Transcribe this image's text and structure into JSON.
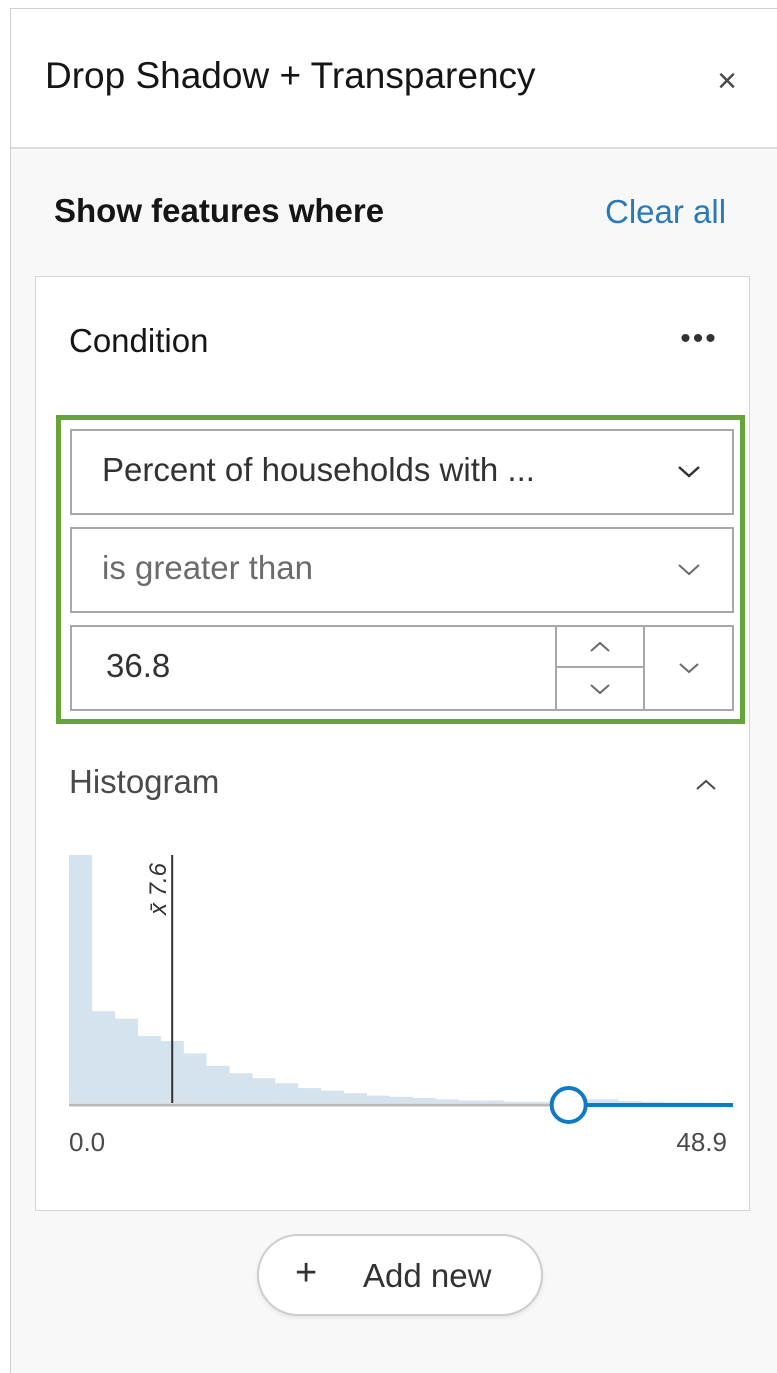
{
  "header": {
    "title": "Drop Shadow + Transparency",
    "close_icon": "×"
  },
  "section": {
    "title": "Show features where",
    "clear_all": "Clear all"
  },
  "condition": {
    "title": "Condition",
    "more_icon": "•••",
    "field": "Percent of households with ...",
    "operator": "is greater than",
    "value": "36.8"
  },
  "histogram": {
    "title": "Histogram",
    "mean_label": "x̄ 7.6",
    "min_label": "0.0",
    "max_label": "48.9",
    "threshold": 36.8,
    "mean": 7.6,
    "min": 0.0,
    "max": 48.9,
    "bins": [
      100,
      37,
      34,
      27,
      25,
      20,
      15,
      12,
      10,
      8,
      6,
      5,
      4,
      3,
      2.5,
      2,
      1.5,
      1,
      1,
      0.5,
      0.5,
      1.5,
      1.5,
      1.5,
      0.8,
      0.5,
      0.3,
      0.2,
      0.1
    ],
    "bar_color": "#d5e3ef",
    "slider_color": "#0f7ac2"
  },
  "add_new": {
    "plus": "+",
    "label": "Add new"
  }
}
